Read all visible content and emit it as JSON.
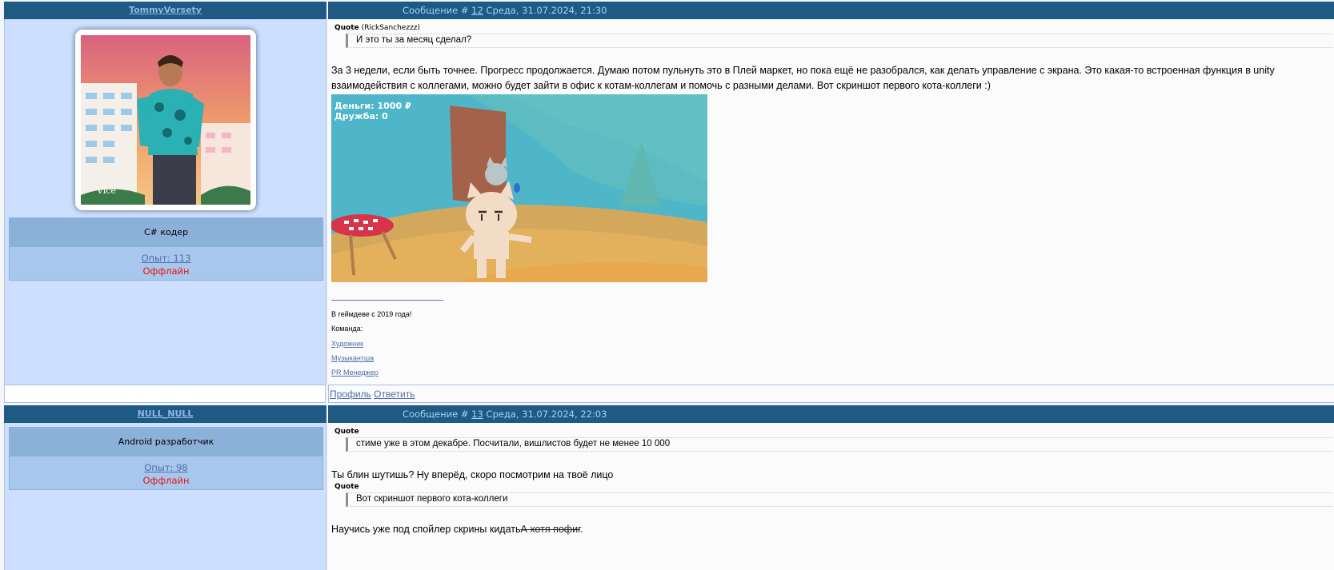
{
  "posts": [
    {
      "author": "TommyVersety",
      "meta_prefix": "Сообщение #",
      "number": "12",
      "date": "Среда, 31.07.2024, 21:30",
      "rank": "C# кодер",
      "experience": "Опыт: 113",
      "status": "Оффлайн",
      "quote_label": "Quote",
      "quote_author": "(RickSanchezzz)",
      "quote_text": "И это ты за месяц сделал?",
      "body_line1": "За 3 недели, если быть точнее. Прогресс продолжается. Думаю потом пульнуть это в Плей маркет, но пока ещё не разобрался, как делать управление с экрана. Это какая-то встроенная функция в unity",
      "body_line2": "взаимодействия с коллегами, можно будет зайти в офис к котам-коллегам и помочь с разными делами. Вот скриншот первого кота-коллеги :)",
      "game_money": "Деньги: 1000 ₽",
      "game_friendship": "Дружба: 0",
      "signature": {
        "line1": "В геймдеве с 2019 года!",
        "line2": "Команда:",
        "links": [
          "Художник",
          "Музыкантша",
          "PR Менеджер"
        ]
      },
      "footer_profile": "Профиль",
      "footer_reply": "Ответить"
    },
    {
      "author": "NULL_NULL",
      "meta_prefix": "Сообщение #",
      "number": "13",
      "date": "Среда, 31.07.2024, 22:03",
      "rank": "Android разработчик",
      "experience": "Опыт: 98",
      "status": "Оффлайн",
      "quote1_label": "Quote",
      "quote1_text": "стиме уже в этом декабре. Посчитали, вишлистов будет не менее 10 000",
      "body_line1": "Ты блин шутишь? Ну вперёд, скоро посмотрим на твоё лицо",
      "quote2_label": "Quote",
      "quote2_text": "Вот скриншот первого кота-коллеги",
      "body_line2": "Научись уже под спойлер скрины кидать",
      "body_strike": "А хотя пофиг",
      "body_end": "."
    }
  ],
  "colors": {
    "header_bar": "#1e5a84",
    "left_panel": "#ccdfff",
    "offline": "#ee1111",
    "link": "#4f6fa8"
  }
}
